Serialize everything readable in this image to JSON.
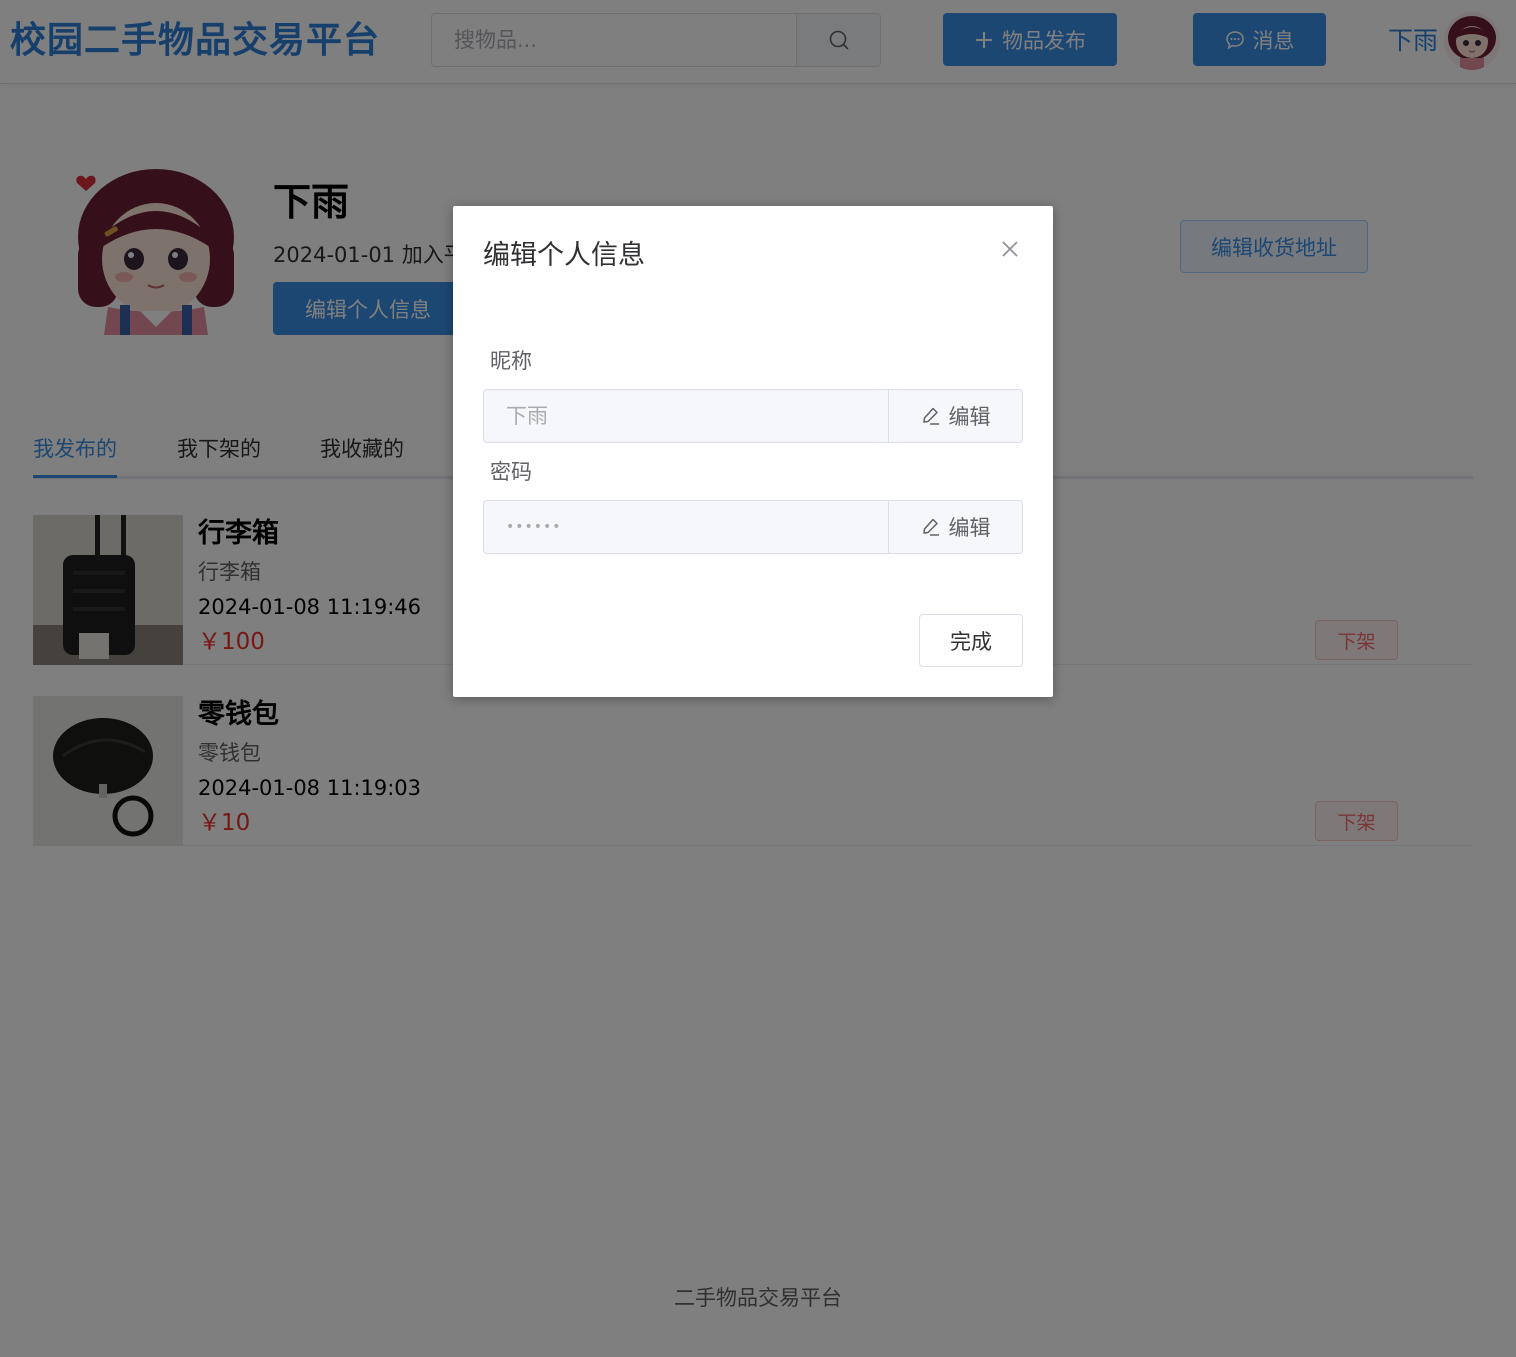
{
  "header": {
    "logo": "校园二手物品交易平台",
    "search_placeholder": "搜物品...",
    "publish_label": "物品发布",
    "message_label": "消息",
    "username": "下雨"
  },
  "profile": {
    "name": "下雨",
    "join_text": "2024-01-01 加入平",
    "edit_info_label": "编辑个人信息",
    "edit_address_label": "编辑收货地址"
  },
  "tabs": [
    {
      "label": "我发布的",
      "active": true
    },
    {
      "label": "我下架的",
      "active": false
    },
    {
      "label": "我收藏的",
      "active": false
    }
  ],
  "items": [
    {
      "title": "行李箱",
      "desc": "行李箱",
      "time": "2024-01-08 11:19:46",
      "price": "￥100",
      "action": "下架"
    },
    {
      "title": "零钱包",
      "desc": "零钱包",
      "time": "2024-01-08 11:19:03",
      "price": "￥10",
      "action": "下架"
    }
  ],
  "footer": "二手物品交易平台",
  "dialog": {
    "title": "编辑个人信息",
    "nickname_label": "昵称",
    "nickname_placeholder": "下雨",
    "password_label": "密码",
    "password_placeholder": "••••••",
    "edit_label": "编辑",
    "done_label": "完成"
  },
  "colors": {
    "primary": "#3a8ee6",
    "logo": "#2f7fd8",
    "price": "#f0302a",
    "danger": "#f56c6c"
  }
}
